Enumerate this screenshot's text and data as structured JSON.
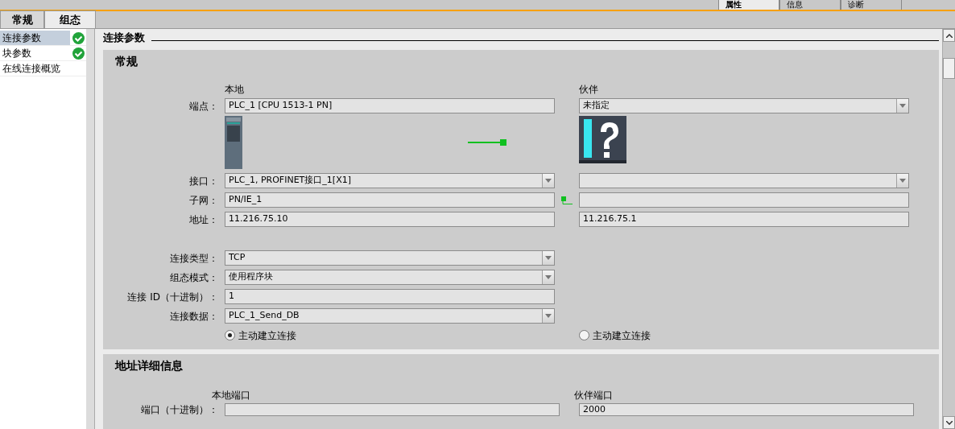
{
  "inspector_tabs": [
    {
      "label": "属性",
      "selected": true
    },
    {
      "label": "信息",
      "selected": false
    },
    {
      "label": "诊断",
      "selected": false
    }
  ],
  "tabs": [
    {
      "label": "常规",
      "selected": false
    },
    {
      "label": "组态",
      "selected": true
    }
  ],
  "sidebar": {
    "items": [
      {
        "label": "连接参数",
        "selected": true,
        "checked": true
      },
      {
        "label": "块参数",
        "selected": false,
        "checked": true
      },
      {
        "label": "在线连接概览",
        "selected": false,
        "checked": false
      }
    ]
  },
  "page_title": "连接参数",
  "general": {
    "title": "常规",
    "local_header": "本地",
    "partner_header": "伙伴",
    "rows": [
      {
        "kind": "field",
        "label": "端点：",
        "local": {
          "kind": "text",
          "value": "PLC_1 [CPU 1513-1 PN]"
        },
        "partner": {
          "kind": "dropdown",
          "value": "未指定"
        }
      },
      {
        "kind": "device"
      },
      {
        "kind": "field",
        "label": "接口：",
        "local": {
          "kind": "dropdown",
          "value": "PLC_1, PROFINET接口_1[X1]"
        },
        "partner": {
          "kind": "dropdown"
        }
      },
      {
        "kind": "field",
        "label": "子网：",
        "link": true,
        "local": {
          "kind": "text",
          "value": "PN/IE_1"
        },
        "partner": {
          "kind": "text"
        }
      },
      {
        "kind": "field",
        "label": "地址：",
        "local": {
          "kind": "text",
          "value": "11.216.75.10"
        },
        "partner": {
          "kind": "text",
          "value": "11.216.75.1"
        }
      },
      {
        "kind": "spacer"
      },
      {
        "kind": "field",
        "label": "连接类型：",
        "local": {
          "kind": "dropdown",
          "value": "TCP"
        }
      },
      {
        "kind": "field",
        "label": "组态模式：",
        "local": {
          "kind": "dropdown",
          "value": "使用程序块"
        }
      },
      {
        "kind": "field",
        "label": "连接 ID（十进制）：",
        "local": {
          "kind": "text",
          "value": "1"
        }
      },
      {
        "kind": "field",
        "label": "连接数据：",
        "local": {
          "kind": "dropdown",
          "value": "PLC_1_Send_DB"
        }
      },
      {
        "kind": "radio",
        "local": {
          "label": "主动建立连接",
          "selected": true
        },
        "partner": {
          "label": "主动建立连接",
          "selected": false
        }
      }
    ]
  },
  "address": {
    "title": "地址详细信息",
    "local_header": "本地端口",
    "partner_header": "伙伴端口",
    "rows": [
      {
        "label": "端口（十进制）：",
        "local": "",
        "partner": "2000"
      }
    ]
  }
}
